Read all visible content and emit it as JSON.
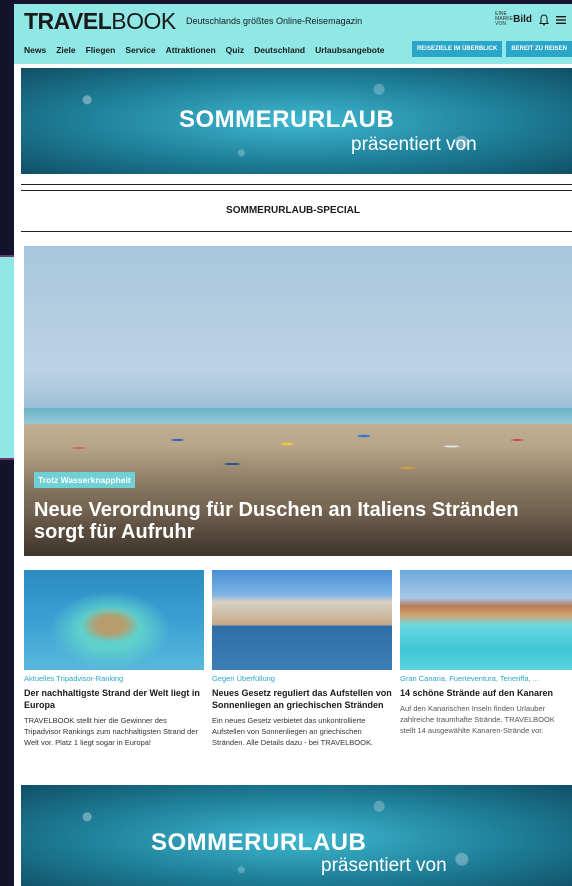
{
  "header": {
    "logo_bold": "TRAVEL",
    "logo_light": "BOOK",
    "tagline": "Deutschlands größtes Online-Reisemagazin",
    "bild_small": "EINE MARKE VON",
    "bild_brand": "Bild"
  },
  "nav": {
    "items": [
      "News",
      "Ziele",
      "Fliegen",
      "Service",
      "Attraktionen",
      "Quiz",
      "Deutschland",
      "Urlaubsangebote"
    ],
    "buttons": [
      "REISEZIELE IM ÜBERBLICK",
      "BEREIT ZU REISEN"
    ]
  },
  "banner": {
    "title": "SOMMERURLAUB",
    "subtitle": "präsentiert von"
  },
  "section_title": "SOMMERURLAUB-SPECIAL",
  "hero": {
    "kicker": "Trotz Wasserknappheit",
    "headline": "Neue Verordnung für Duschen an Italiens Stränden sorgt für Aufruhr"
  },
  "cards": [
    {
      "kicker": "Aktuelles Tripadvisor-Ranking",
      "title": "Der nachhaltigste Strand der Welt liegt in Europa",
      "text": "TRAVELBOOK stellt hier die Gewinner des Tripadvisor Rankings zum nachhaltigsten Strand der Welt vor. Platz 1 liegt sogar in Europa!"
    },
    {
      "kicker": "Gegen Überfüllung",
      "title": "Neues Gesetz reguliert das Aufstellen von Sonnenliegen an griechischen Stränden",
      "text": "Ein neues Gesetz verbietet das unkontrollierte Aufstellen von Sonnenliegen an griechischen Stränden. Alle Details dazu - bei TRAVELBOOK."
    },
    {
      "kicker": "Gran Canaria, Fuerteventura, Teneriffa, ...",
      "title": "14 schöne Strände auf den Kanaren",
      "text": "Auf den Kanarischen Inseln finden Urlauber zahlreiche traumhafte Strände. TRAVELBOOK stellt 14 ausgewählte Kanaren-Strände vor."
    }
  ],
  "colors": {
    "header_bg": "#8fe8e6",
    "accent": "#2aa6c9",
    "body_bg": "#13142b"
  }
}
